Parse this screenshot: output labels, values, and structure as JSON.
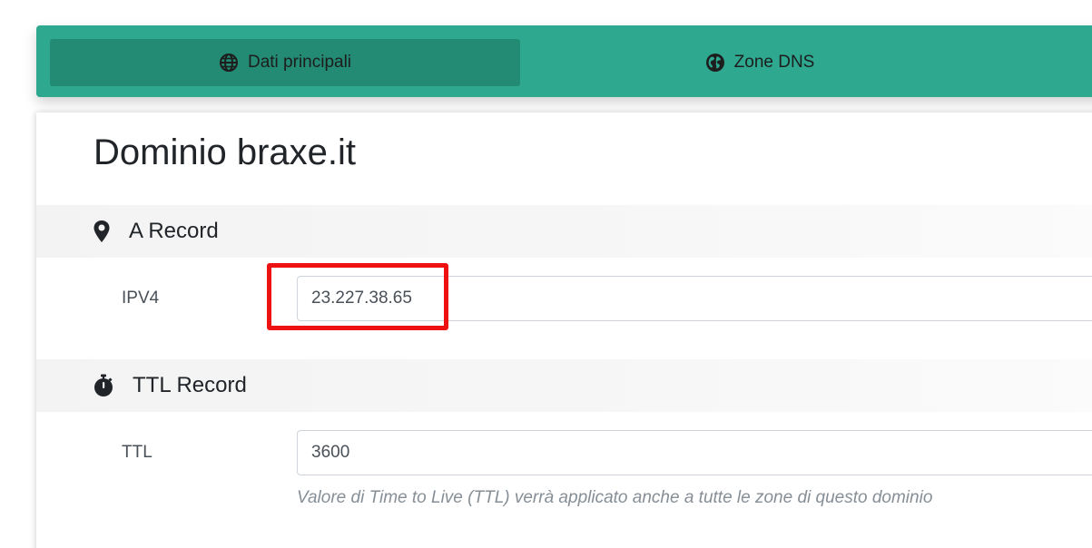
{
  "tabs": [
    {
      "label": "Dati principali",
      "icon": "globe-icon",
      "active": true
    },
    {
      "label": "Zone DNS",
      "icon": "globe-americas-icon",
      "active": false
    }
  ],
  "header": {
    "title_prefix": "Dominio",
    "domain": "braxe.it"
  },
  "sections": {
    "a_record": {
      "title": "A Record",
      "icon": "map-marker-icon",
      "field_label": "IPV4",
      "field_value": "23.227.38.65"
    },
    "ttl_record": {
      "title": "TTL Record",
      "icon": "stopwatch-icon",
      "field_label": "TTL",
      "field_value": "3600",
      "help_text": "Valore di Time to Live (TTL) verrà applicato anche a tutte le zone di questo dominio"
    }
  },
  "colors": {
    "tabbar": "#2ea88f",
    "tab_active": "#238a73",
    "highlight": "#ee1111"
  }
}
